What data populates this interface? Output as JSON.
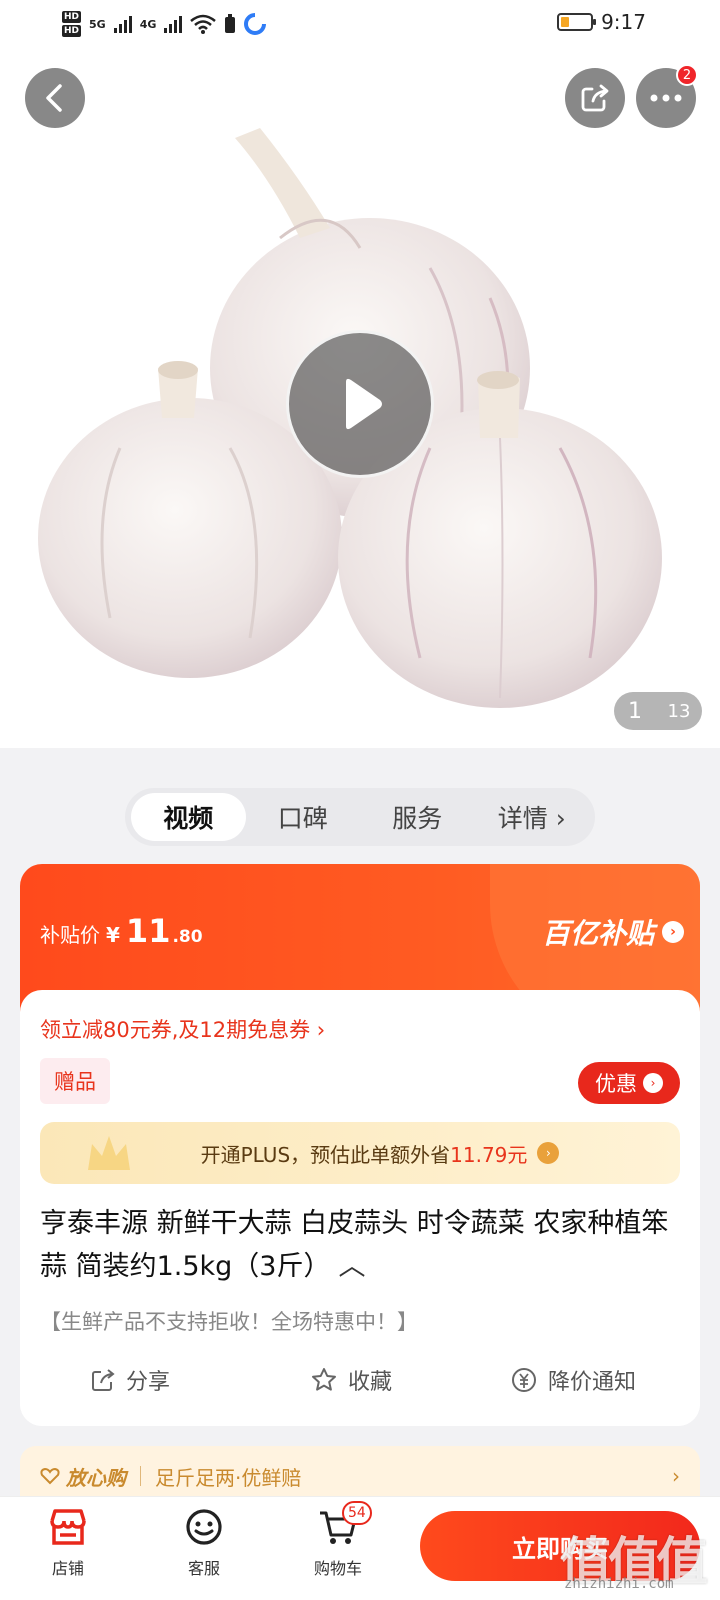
{
  "status_bar": {
    "hd_labels": [
      "HD",
      "HD"
    ],
    "net_labels": [
      "5G",
      "4G"
    ],
    "time": "9:17"
  },
  "hero": {
    "notification_badge": "2",
    "image_counter_current": "1",
    "image_counter_total": "13"
  },
  "tabs": [
    {
      "label": "视频",
      "active": true
    },
    {
      "label": "口碑",
      "active": false
    },
    {
      "label": "服务",
      "active": false
    },
    {
      "label": "详情 ›",
      "active": false
    }
  ],
  "price": {
    "label": "补贴价",
    "currency": "¥",
    "integer": "11",
    "decimal": ".80",
    "program_logo": "百亿补贴"
  },
  "promo": {
    "coupon_text": "领立减80元券,及12期免息券 ›",
    "gift_tag": "赠品",
    "discount_button": "优惠",
    "plus_prefix": "开通PLUS，预估此单额外省",
    "plus_amount": "11.79元"
  },
  "product": {
    "title": "亨泰丰源 新鲜干大蒜 白皮蒜头 时令蔬菜 农家种植笨蒜 简装约1.5kg（3斤）",
    "slogan": "【生鲜产品不支持拒收！全场特惠中！】"
  },
  "actions": {
    "share": "分享",
    "favorite": "收藏",
    "price_alert": "降价通知"
  },
  "assurance": {
    "label": "放心购",
    "detail": "足斤足两·优鲜赔"
  },
  "bottom_bar": {
    "store": "店铺",
    "service": "客服",
    "cart": "购物车",
    "cart_count": "54",
    "buy_button": "立即购买"
  },
  "watermark": {
    "chars": "值值值",
    "url": "zhizhizhi.com"
  },
  "colors": {
    "accent": "#ff4a1c",
    "price_red": "#e8341c",
    "gold": "#c98a2e"
  }
}
